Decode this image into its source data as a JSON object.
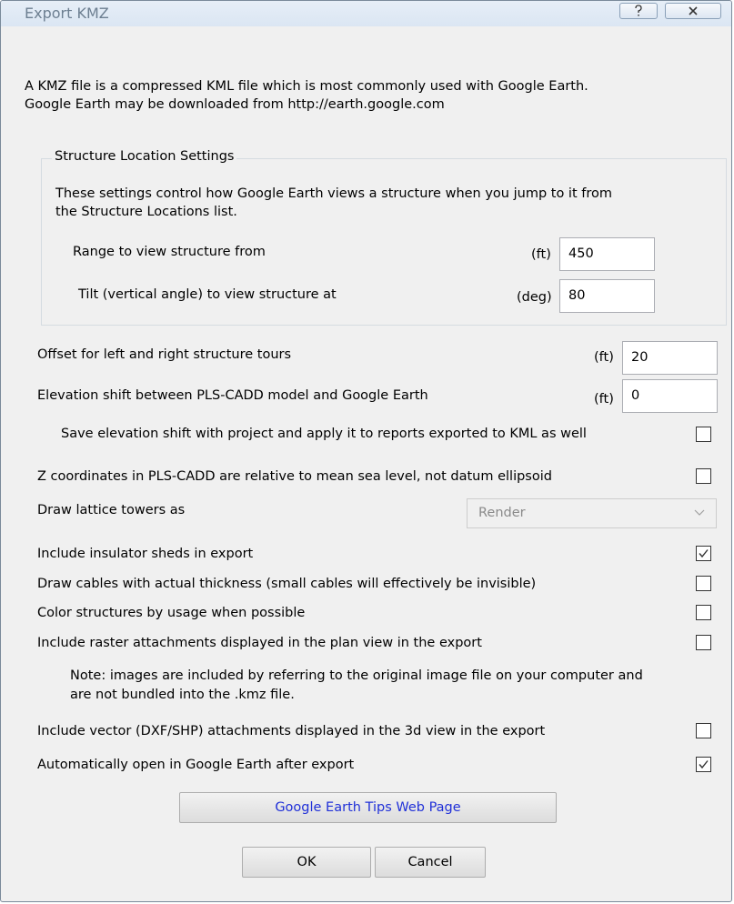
{
  "window": {
    "title": "Export KMZ"
  },
  "intro": {
    "line1": "A KMZ file is a compressed KML file which is most commonly used with Google Earth.",
    "line2": "Google Earth may be downloaded from http://earth.google.com"
  },
  "structure_group": {
    "title": "Structure Location Settings",
    "desc1": "These settings control how Google Earth views a structure when you jump to it from",
    "desc2": "the Structure Locations list.",
    "range": {
      "label": "Range to view structure from",
      "unit": "(ft)",
      "value": "450"
    },
    "tilt": {
      "label": "Tilt (vertical angle) to view structure at",
      "unit": "(deg)",
      "value": "80"
    }
  },
  "offset": {
    "label": "Offset for left and right structure tours",
    "unit": "(ft)",
    "value": "20"
  },
  "elevation_shift": {
    "label": "Elevation shift between PLS-CADD model and Google Earth",
    "unit": "(ft)",
    "value": "0"
  },
  "options": {
    "save_shift": {
      "label": "Save elevation shift with project and apply it to reports exported to KML as well",
      "checked": false
    },
    "z_coords": {
      "label": "Z coordinates in PLS-CADD are relative to mean sea level, not datum ellipsoid",
      "checked": false
    },
    "lattice": {
      "label": "Draw lattice towers as",
      "value": "Render"
    },
    "insulator_sheds": {
      "label": "Include insulator sheds in export",
      "checked": true
    },
    "cable_thickness": {
      "label": "Draw cables with actual thickness (small cables will effectively be invisible)",
      "checked": false
    },
    "color_usage": {
      "label": "Color structures by usage when possible",
      "checked": false
    },
    "raster": {
      "label": "Include raster attachments displayed in the plan view in the export",
      "checked": false
    },
    "raster_note1": "Note: images are included by referring to the original image file on your computer and",
    "raster_note2": "are not bundled into the .kmz file.",
    "vector": {
      "label": "Include vector (DXF/SHP) attachments displayed in the 3d view in the export",
      "checked": false
    },
    "auto_open": {
      "label": "Automatically open in Google Earth after export",
      "checked": true
    }
  },
  "buttons": {
    "tips": "Google Earth Tips Web Page",
    "ok": "OK",
    "cancel": "Cancel"
  }
}
